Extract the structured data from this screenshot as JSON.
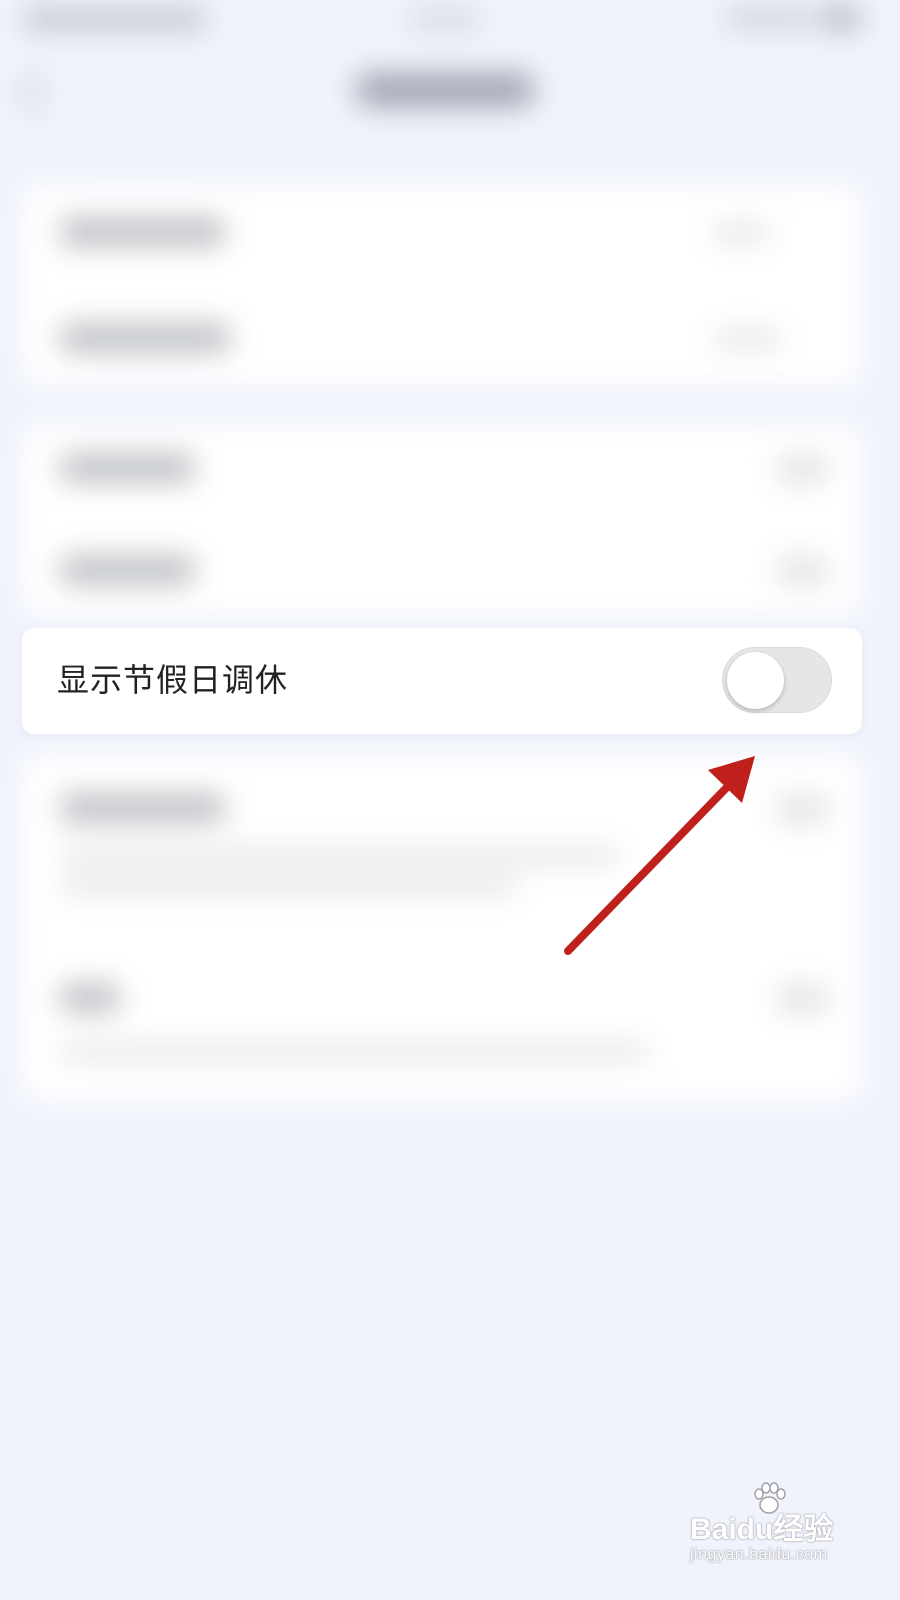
{
  "setting_row": {
    "label": "显示节假日调休",
    "toggle_on": false
  },
  "annotation": {
    "arrow_color": "#c0201b"
  },
  "watermark": {
    "brand": "Baidu经验",
    "url": "jingyan.baidu.com"
  },
  "colors": {
    "background": "#f0f3fc",
    "toggle_off_track": "#e6e6e9",
    "toggle_knob": "#ffffff",
    "label_text": "#222222"
  }
}
